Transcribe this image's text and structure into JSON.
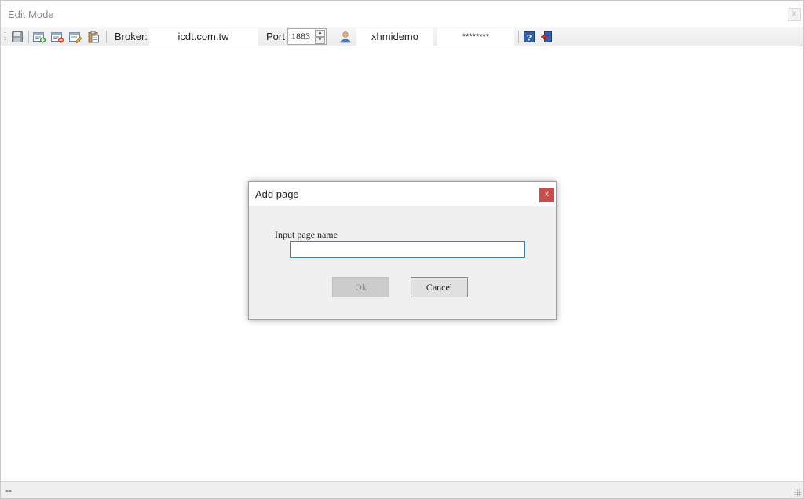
{
  "window": {
    "title": "Edit Mode",
    "close_glyph": "x"
  },
  "toolbar": {
    "broker_label": "Broker:",
    "broker_value": "icdt.com.tw",
    "port_label": "Port",
    "port_value": "1883",
    "username": "xhmidemo",
    "password": "********",
    "icons": [
      "save-icon",
      "add-page-icon",
      "remove-page-icon",
      "edit-page-icon",
      "paste-icon",
      "user-icon",
      "help-icon",
      "exit-icon"
    ]
  },
  "dialog": {
    "title": "Add page",
    "close_glyph": "x",
    "label": "Input page name",
    "input_value": "",
    "ok_label": "Ok",
    "cancel_label": "Cancel",
    "close_color": "#c94d4d"
  },
  "statusbar": {
    "text": "--"
  }
}
